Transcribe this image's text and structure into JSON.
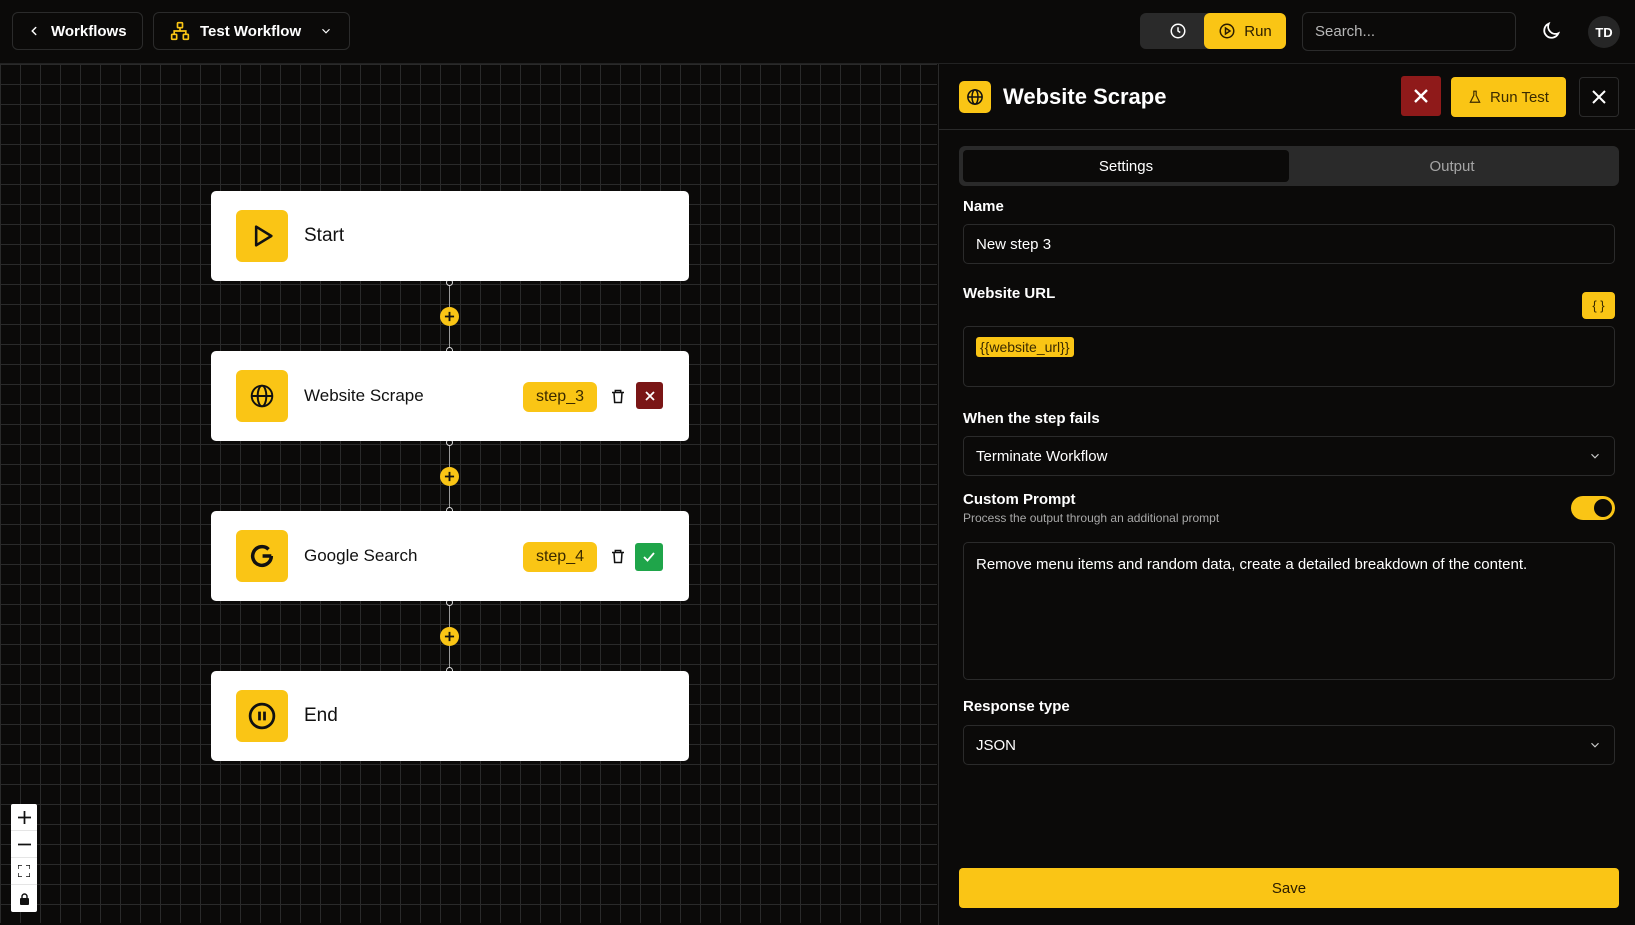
{
  "topbar": {
    "back_label": "Workflows",
    "workflow_name": "Test Workflow",
    "run_label": "Run",
    "search_placeholder": "Search...",
    "avatar_initials": "TD"
  },
  "canvas": {
    "nodes": [
      {
        "title": "Start",
        "icon": "play-icon"
      },
      {
        "title": "Website Scrape",
        "icon": "globe-icon",
        "step_id": "step_3",
        "status": "failed"
      },
      {
        "title": "Google Search",
        "icon": "google-g-icon",
        "step_id": "step_4",
        "status": "success"
      },
      {
        "title": "End",
        "icon": "pause-circle-icon"
      }
    ],
    "controls": [
      "zoom-in-icon",
      "zoom-out-icon",
      "fit-view-icon",
      "lock-icon"
    ]
  },
  "panel": {
    "title": "Website Scrape",
    "run_test_label": "Run Test",
    "tabs": [
      {
        "label": "Settings",
        "active": true
      },
      {
        "label": "Output",
        "active": false
      }
    ],
    "name_label": "Name",
    "name_value": "New step 3",
    "url_label": "Website URL",
    "url_variable": "{{website_url}}",
    "brace_label": "{ }",
    "fail_label": "When the step fails",
    "fail_value": "Terminate Workflow",
    "custom_prompt_label": "Custom Prompt",
    "custom_prompt_sub": "Process the output through an additional prompt",
    "custom_prompt_enabled": true,
    "prompt_value": "Remove menu items and random data, create a detailed breakdown of the content.",
    "response_label": "Response type",
    "response_value": "JSON",
    "save_label": "Save"
  },
  "colors": {
    "accent": "#fac515",
    "background": "#0b0a09",
    "error": "#8f1a1a",
    "success": "#1fa54a"
  }
}
